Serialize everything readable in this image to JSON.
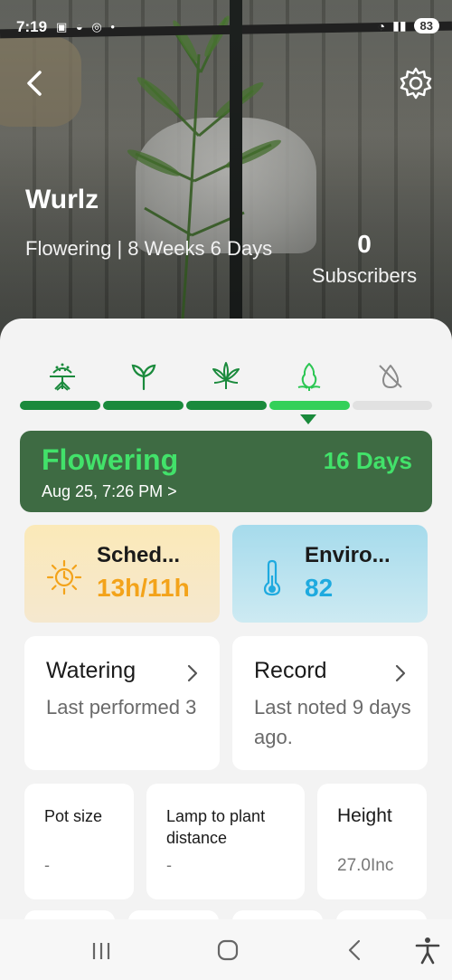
{
  "status_bar": {
    "time": "7:19",
    "battery": "83"
  },
  "plant": {
    "name": "Wurlz",
    "stage_text": "Flowering | 8 Weeks 6 Days",
    "subscribers_count": "0",
    "subscribers_label": "Subscribers"
  },
  "stages": {
    "items": [
      "germination-icon",
      "seedling-icon",
      "vegetative-icon",
      "flowering-icon",
      "harvest-icon"
    ],
    "current_index": 3,
    "colors": {
      "done": "#1a8a3c",
      "current": "#34d059",
      "pending": "#e1e1e1"
    }
  },
  "stage_card": {
    "title": "Flowering",
    "days": "16 Days",
    "date": "Aug 25, 7:26 PM >"
  },
  "schedule_tile": {
    "title": "Sched...",
    "value": "13h/11h",
    "color": "#f3a31a"
  },
  "environment_tile": {
    "title": "Enviro...",
    "value": "82",
    "color": "#1eaadf"
  },
  "watering_card": {
    "title": "Watering",
    "subtitle": "Last performed 3"
  },
  "record_card": {
    "title": "Record",
    "subtitle": "Last noted 9 days ago."
  },
  "metrics": {
    "pot_size": {
      "label": "Pot size",
      "value": "-"
    },
    "lamp_distance": {
      "label": "Lamp to plant distance",
      "value": "-"
    },
    "height": {
      "label": "Height",
      "value": "27.0Inc"
    }
  },
  "nav": {
    "icons": [
      "recent-apps-icon",
      "home-icon",
      "back-icon",
      "accessibility-icon"
    ]
  }
}
